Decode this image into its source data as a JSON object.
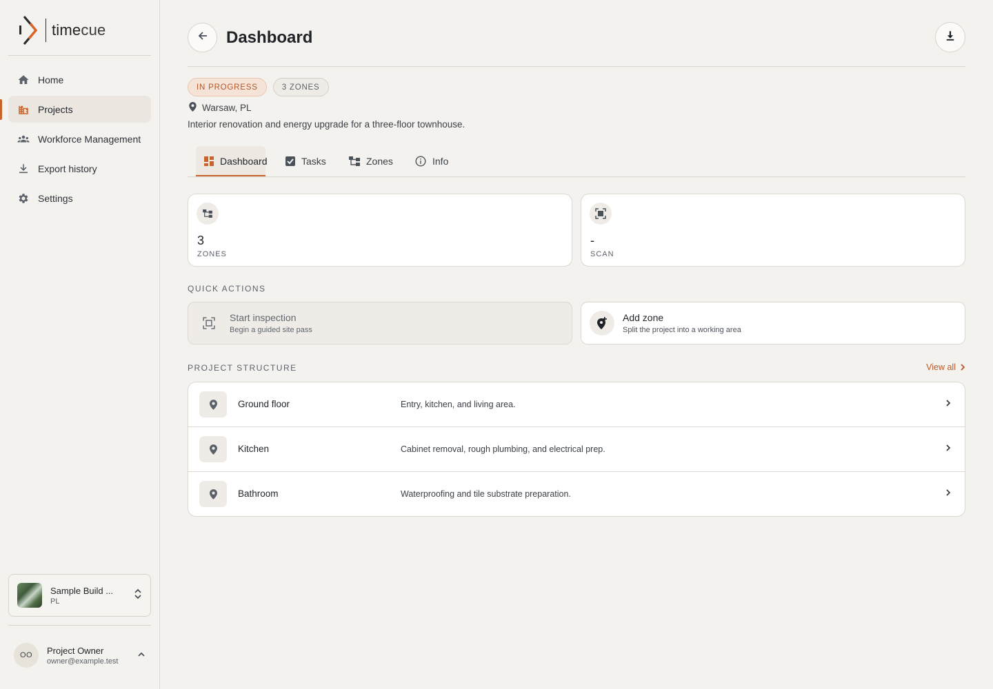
{
  "app": {
    "logo_text_a": "time",
    "logo_text_b": "cue",
    "brand_color": "#c8642a"
  },
  "sidebar": {
    "items": [
      {
        "label": "Home",
        "icon": "home-icon"
      },
      {
        "label": "Projects",
        "icon": "buildings-icon",
        "active": true
      },
      {
        "label": "Workforce Management",
        "icon": "people-icon"
      },
      {
        "label": "Export history",
        "icon": "download-icon"
      },
      {
        "label": "Settings",
        "icon": "gear-icon"
      }
    ],
    "project_switcher": {
      "name": "Sample Build ...",
      "sub": "PL"
    },
    "user": {
      "initials": "OO",
      "name": "Project Owner",
      "email": "owner@example.test"
    }
  },
  "header": {
    "title": "Dashboard"
  },
  "project": {
    "status_badge": "IN PROGRESS",
    "zones_badge": "3 ZONES",
    "location": "Warsaw, PL",
    "description": "Interior renovation and energy upgrade for a three-floor townhouse."
  },
  "tabs": [
    {
      "label": "Dashboard",
      "icon": "grid-icon",
      "active": true
    },
    {
      "label": "Tasks",
      "icon": "checkbox-icon"
    },
    {
      "label": "Zones",
      "icon": "tree-icon"
    },
    {
      "label": "Info",
      "icon": "info-icon"
    }
  ],
  "stats": [
    {
      "value": "3",
      "label": "ZONES",
      "icon": "tree-icon"
    },
    {
      "value": "-",
      "label": "SCAN",
      "icon": "scan-icon"
    }
  ],
  "quick_actions": {
    "label": "QUICK ACTIONS",
    "items": [
      {
        "title": "Start inspection",
        "subtitle": "Begin a guided site pass",
        "icon": "scan-icon",
        "disabled": true
      },
      {
        "title": "Add zone",
        "subtitle": "Split the project into a working area",
        "icon": "add-location-icon",
        "disabled": false
      }
    ]
  },
  "structure": {
    "label": "PROJECT STRUCTURE",
    "view_all": "View all",
    "zones": [
      {
        "name": "Ground floor",
        "description": "Entry, kitchen, and living area."
      },
      {
        "name": "Kitchen",
        "description": "Cabinet removal, rough plumbing, and electrical prep."
      },
      {
        "name": "Bathroom",
        "description": "Waterproofing and tile substrate preparation."
      }
    ]
  }
}
